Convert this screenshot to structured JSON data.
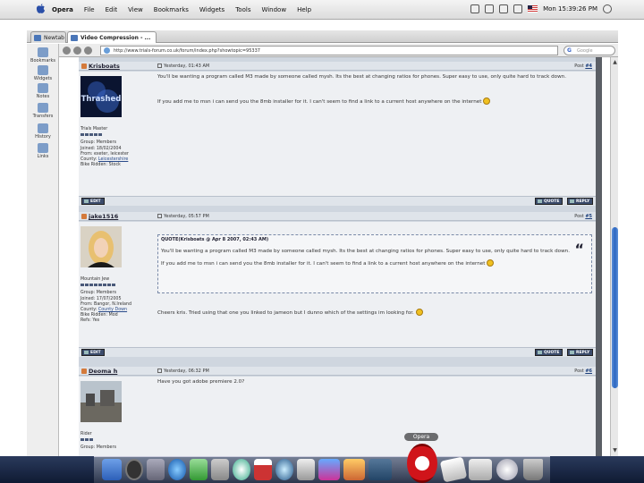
{
  "menubar": {
    "app_name": "Opera",
    "items": [
      "File",
      "Edit",
      "View",
      "Bookmarks",
      "Widgets",
      "Tools",
      "Window",
      "Help"
    ],
    "clock": "Mon 15:39:26 PM"
  },
  "tabs": [
    {
      "label": "Newtab"
    },
    {
      "label": "Video Compression - ..."
    }
  ],
  "address": {
    "url": "http://www.trials-forum.co.uk/forum/index.php?showtopic=95337",
    "search_placeholder": "Google"
  },
  "side_panel": {
    "items": [
      "Bookmarks",
      "Widgets",
      "Notes",
      "Transfers",
      "History",
      "Links"
    ]
  },
  "posts": [
    {
      "author": "Krisboats",
      "date": "Yesterday, 01:43 AM",
      "post_label": "Post",
      "number": "#4",
      "avatar_text": "Thrashed",
      "title": "Trials Master",
      "group": "Group: Members",
      "joined": "Joined: 18/02/2004",
      "from": "From: exeter, leicester",
      "county": "County:",
      "county_link": "Leicestershire",
      "bike": "Bike Ridden: Stock",
      "body": [
        "You'll be wanting a program called M3 made by someone called mysh. Its the best at changing ratios for phones. Super easy to use, only quite hard to track down.",
        "If you add me to msn i can send you the 8mb installer for it. I can't seem to find a link to a current host anywhere on the internet"
      ],
      "edit_label": "EDIT",
      "quote_label": "QUOTE",
      "reply_label": "REPLY"
    },
    {
      "author": "jake1516",
      "date": "Yesterday, 05:57 PM",
      "post_label": "Post",
      "number": "#5",
      "title": "Mountain Jew",
      "group": "Group: Members",
      "joined": "Joined: 17/07/2005",
      "from": "From: Bangor, N.Ireland",
      "county": "County:",
      "county_link": "County Down",
      "bike": "Bike Ridden: Mod",
      "refs": "Refs: Yes",
      "quote_header": "QUOTE(Krisboats @ Apr 8 2007, 02:43 AM)",
      "quote_body": [
        "You'll be wanting a program called M3 made by someone called mysh. Its the best at changing ratios for phones. Super easy to use, only quite hard to track down.",
        "If you add me to msn i can send you the 8mb installer for it. I can't seem to find a link to a current host anywhere on the internet"
      ],
      "body": "Cheers kris. Tried using that one you linked to jameon but I dunno which of the settings im looking for.",
      "edit_label": "EDIT",
      "quote_label": "QUOTE",
      "reply_label": "REPLY"
    },
    {
      "author": "Deoma h",
      "date": "Yesterday, 06:32 PM",
      "post_label": "Post",
      "number": "#6",
      "title": "Rider",
      "group": "Group: Members",
      "body": "Have you got adobe premiere 2.0?"
    }
  ],
  "dock": {
    "hover_label": "Opera"
  }
}
